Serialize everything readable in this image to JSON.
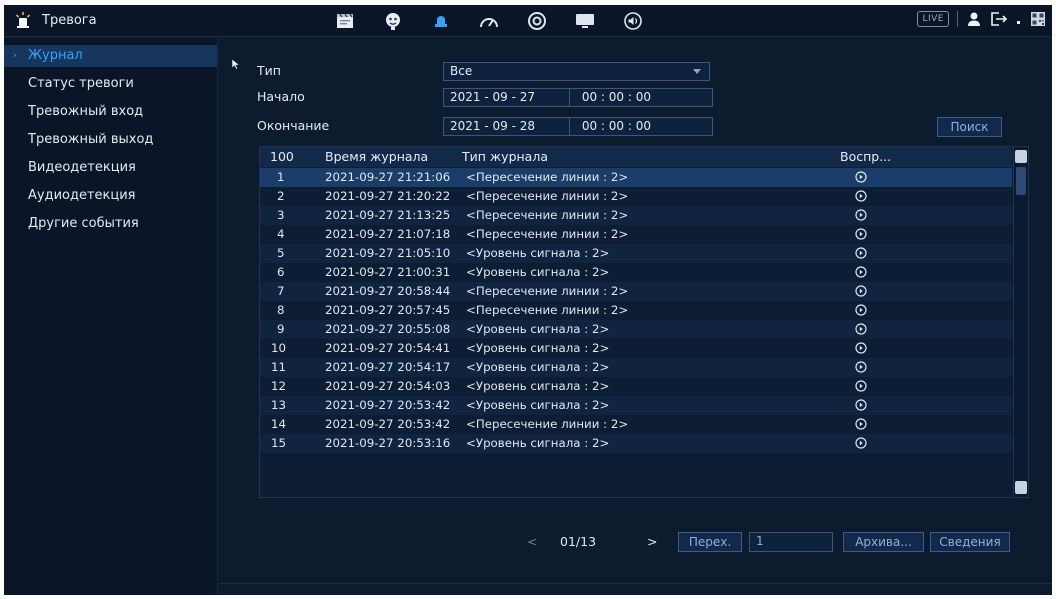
{
  "topbar": {
    "title": "Тревога",
    "title_icon": "alarm-light-icon",
    "nav_icons": [
      "clapper-icon",
      "face-icon",
      "alarm-light-icon",
      "gauge-icon",
      "disc-icon",
      "monitor-icon",
      "speaker-icon"
    ],
    "live_label": "LIVE",
    "accent": "#33a3ff"
  },
  "sidebar": {
    "items": [
      {
        "label": "Журнал",
        "active": true
      },
      {
        "label": "Статус тревоги"
      },
      {
        "label": "Тревожный вход"
      },
      {
        "label": "Тревожный выход"
      },
      {
        "label": "Видеодетекция"
      },
      {
        "label": "Аудиодетекция"
      },
      {
        "label": "Другие события"
      }
    ]
  },
  "filters": {
    "type_label": "Тип",
    "type_value": "Все",
    "start_label": "Начало",
    "start_date": "2021 - 09 - 27",
    "start_time": "00 : 00 : 00",
    "end_label": "Окончание",
    "end_date": "2021 - 09 - 28",
    "end_time": "00 : 00 : 00",
    "search_label": "Поиск"
  },
  "table": {
    "headers": {
      "count": "100",
      "time": "Время журнала",
      "type": "Тип журнала",
      "play": "Воспр..."
    },
    "rows": [
      {
        "n": "1",
        "time": "2021-09-27 21:21:06",
        "type": "<Пересечение линии : 2>"
      },
      {
        "n": "2",
        "time": "2021-09-27 21:20:22",
        "type": "<Пересечение линии : 2>"
      },
      {
        "n": "3",
        "time": "2021-09-27 21:13:25",
        "type": "<Пересечение линии : 2>"
      },
      {
        "n": "4",
        "time": "2021-09-27 21:07:18",
        "type": "<Пересечение линии : 2>"
      },
      {
        "n": "5",
        "time": "2021-09-27 21:05:10",
        "type": "<Уровень сигнала : 2>"
      },
      {
        "n": "6",
        "time": "2021-09-27 21:00:31",
        "type": "<Уровень сигнала : 2>"
      },
      {
        "n": "7",
        "time": "2021-09-27 20:58:44",
        "type": "<Пересечение линии : 2>"
      },
      {
        "n": "8",
        "time": "2021-09-27 20:57:45",
        "type": "<Пересечение линии : 2>"
      },
      {
        "n": "9",
        "time": "2021-09-27 20:55:08",
        "type": "<Уровень сигнала : 2>"
      },
      {
        "n": "10",
        "time": "2021-09-27 20:54:41",
        "type": "<Уровень сигнала : 2>"
      },
      {
        "n": "11",
        "time": "2021-09-27 20:54:17",
        "type": "<Уровень сигнала : 2>"
      },
      {
        "n": "12",
        "time": "2021-09-27 20:54:03",
        "type": "<Уровень сигнала : 2>"
      },
      {
        "n": "13",
        "time": "2021-09-27 20:53:42",
        "type": "<Уровень сигнала : 2>"
      },
      {
        "n": "14",
        "time": "2021-09-27 20:53:42",
        "type": "<Пересечение линии : 2>"
      },
      {
        "n": "15",
        "time": "2021-09-27 20:53:16",
        "type": "<Уровень сигнала : 2>"
      }
    ]
  },
  "pager": {
    "prev": "<",
    "page": "01/13",
    "next": ">",
    "go_label": "Перех.",
    "go_value": "1",
    "archive_label": "Архива...",
    "details_label": "Сведения"
  }
}
